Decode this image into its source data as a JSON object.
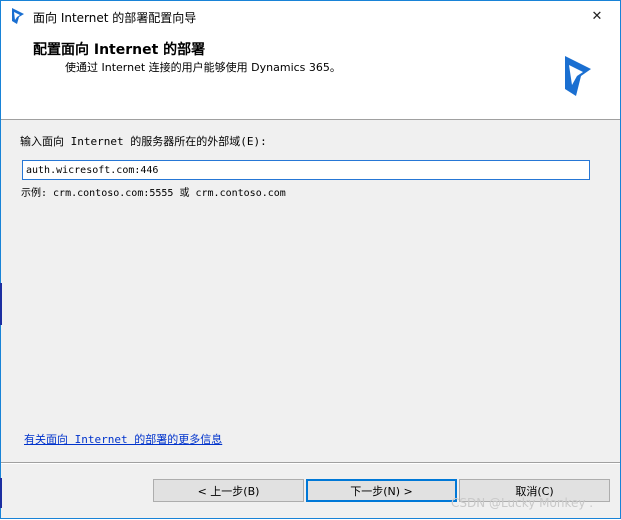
{
  "window": {
    "title": "面向 Internet 的部署配置向导",
    "close_glyph": "✕"
  },
  "header": {
    "title": "配置面向 Internet 的部署",
    "subtitle": "使通过 Internet 连接的用户能够使用 Dynamics 365。"
  },
  "form": {
    "label": "输入面向 Internet 的服务器所在的外部域(E):",
    "domain_value": "auth.wicresoft.com:446",
    "example": "示例: crm.contoso.com:5555 或 crm.contoso.com"
  },
  "link": {
    "more_info": "有关面向 Internet 的部署的更多信息"
  },
  "buttons": {
    "back": "< 上一步(B)",
    "next": "下一步(N) >",
    "cancel": "取消(C)"
  },
  "watermark": "CSDN @Lucky Monkey .",
  "icons": {
    "app_logo": "dynamics-logo-icon",
    "close": "close-icon"
  },
  "colors": {
    "brand": "#1a6fd1",
    "link": "#0033cc",
    "focus_border": "#0078d7"
  }
}
